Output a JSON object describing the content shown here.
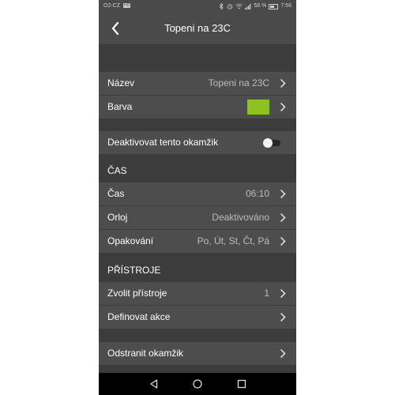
{
  "status_bar": {
    "carrier": "O2-CZ",
    "badge": "HD",
    "signal_text": "…‥‥",
    "battery_percent": "58 %",
    "time": "7:56"
  },
  "header": {
    "title": "Topeni na 23C",
    "back_icon": "chevron-left-icon"
  },
  "general": {
    "name_label": "Název",
    "name_value": "Topeni na 23C",
    "color_label": "Barva",
    "color_value": "#8dc21f",
    "deactivate_label": "Deaktivovat tento okamžik",
    "deactivate_on": false
  },
  "time_section": {
    "header": "ČAS",
    "time_label": "Čas",
    "time_value": "06:10",
    "orloj_label": "Orloj",
    "orloj_value": "Deaktivováno",
    "repeat_label": "Opakování",
    "repeat_value": "Po, Út, St, Čt, Pá"
  },
  "devices_section": {
    "header": "PŘÍSTROJE",
    "choose_label": "Zvolit přístroje",
    "choose_value": "1",
    "define_label": "Definovat akce"
  },
  "delete": {
    "label": "Odstranit okamžik"
  },
  "colors": {
    "background": "#3c3c3c",
    "row": "#4d4d4d",
    "header": "#4a4a4a",
    "accent_swatch": "#8dc21f"
  },
  "nav_bar": {
    "back_icon": "triangle-back-icon",
    "home_icon": "circle-home-icon",
    "recents_icon": "square-recents-icon"
  }
}
